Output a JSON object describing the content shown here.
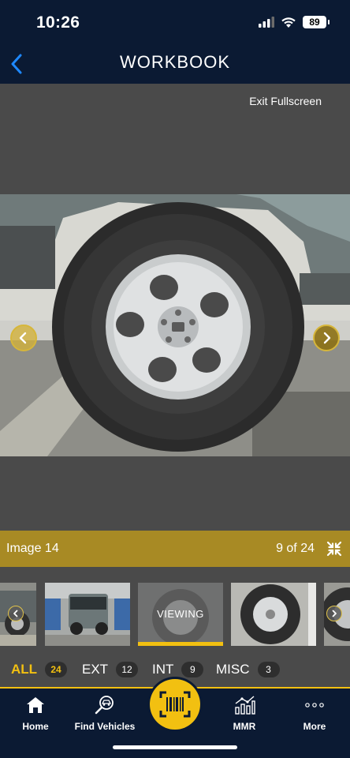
{
  "status": {
    "time": "10:26",
    "battery": "89"
  },
  "nav": {
    "title": "WORKBOOK"
  },
  "viewer": {
    "exit_label": "Exit Fullscreen"
  },
  "image_bar": {
    "title": "Image 14",
    "count": "9 of 24"
  },
  "thumbnails": {
    "viewing_label": "VIEWING"
  },
  "filters": [
    {
      "label": "ALL",
      "count": "24",
      "active": true
    },
    {
      "label": "EXT",
      "count": "12",
      "active": false
    },
    {
      "label": "INT",
      "count": "9",
      "active": false
    },
    {
      "label": "MISC",
      "count": "3",
      "active": false
    }
  ],
  "tabs": {
    "home": "Home",
    "find": "Find Vehicles",
    "mmr": "MMR",
    "more": "More"
  },
  "colors": {
    "navy": "#0b1a33",
    "gold": "#f2c011",
    "image_bar": "#a88a24",
    "viewer_bg": "#4a4a4a",
    "back_arrow": "#1e88ff"
  },
  "icons": [
    "back-chevron-icon",
    "signal-icon",
    "wifi-icon",
    "battery-icon",
    "collapse-icon",
    "chevron-left-icon",
    "chevron-right-icon",
    "home-icon",
    "find-vehicles-icon",
    "barcode-scan-icon",
    "mmr-chart-icon",
    "more-dots-icon"
  ]
}
